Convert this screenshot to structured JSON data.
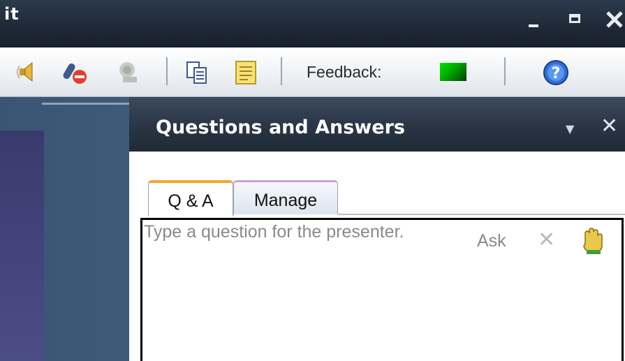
{
  "window": {
    "title_fragment": "it",
    "minimize_label": "Minimize",
    "restore_label": "Restore",
    "close_label": "Close"
  },
  "toolbar": {
    "icons": [
      "speaker-icon",
      "mic-mute-icon",
      "webcam-icon",
      "copy-icon",
      "notes-icon"
    ],
    "feedback_label": "Feedback:",
    "feedback_color": "#00c000",
    "help_icon": "help-icon"
  },
  "qa_panel": {
    "title": "Questions and Answers",
    "tabs": [
      {
        "label": "Q & A",
        "active": true
      },
      {
        "label": "Manage",
        "active": false
      }
    ],
    "question_placeholder": "Type a question for the presenter.",
    "ask_label": "Ask",
    "clear_icon": "clear-icon",
    "raise_hand_icon": "raise-hand-icon"
  }
}
